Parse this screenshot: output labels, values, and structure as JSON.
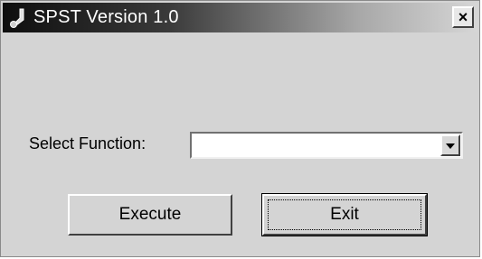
{
  "window": {
    "title": "SPST Version 1.0",
    "close_label": "×"
  },
  "form": {
    "function_label": "Select Function:",
    "function_value": ""
  },
  "buttons": {
    "execute_label": "Execute",
    "exit_label": "Exit"
  },
  "icons": {
    "app": "app-icon",
    "close": "close-icon",
    "dropdown": "chevron-down-icon"
  },
  "colors": {
    "window_bg": "#d4d4d4",
    "titlebar_dark": "#0e0e0e",
    "titlebar_light": "#d6d6d6"
  }
}
